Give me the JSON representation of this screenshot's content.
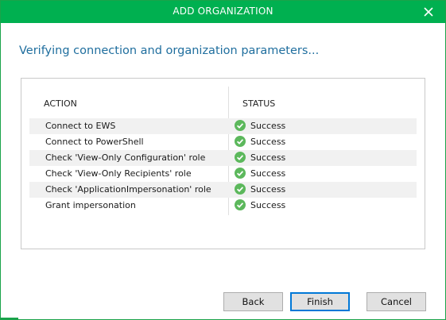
{
  "window": {
    "title": "ADD ORGANIZATION",
    "accent_color": "#00b050"
  },
  "heading": "Verifying connection and organization parameters...",
  "table": {
    "columns": [
      "ACTION",
      "STATUS"
    ],
    "rows": [
      {
        "action": "Connect to EWS",
        "status": "Success",
        "icon": "success-check-icon"
      },
      {
        "action": "Connect to PowerShell",
        "status": "Success",
        "icon": "success-check-icon"
      },
      {
        "action": "Check 'View-Only Configuration' role",
        "status": "Success",
        "icon": "success-check-icon"
      },
      {
        "action": "Check 'View-Only Recipients' role",
        "status": "Success",
        "icon": "success-check-icon"
      },
      {
        "action": "Check 'ApplicationImpersonation' role",
        "status": "Success",
        "icon": "success-check-icon"
      },
      {
        "action": "Grant impersonation",
        "status": "Success",
        "icon": "success-check-icon"
      }
    ]
  },
  "buttons": {
    "back": "Back",
    "finish": "Finish",
    "cancel": "Cancel"
  }
}
